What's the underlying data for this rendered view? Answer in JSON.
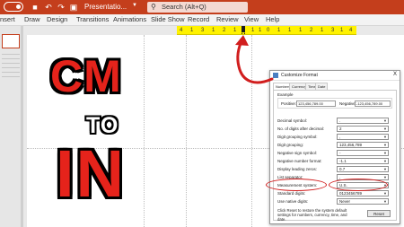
{
  "titlebar": {
    "title": "Presentatio...",
    "search_placeholder": "Search (Alt+Q)",
    "bg_color": "#c43e1c"
  },
  "ribbon_tabs": [
    "nsert",
    "Draw",
    "Design",
    "Transitions",
    "Animations",
    "Slide Show",
    "Record",
    "Review",
    "View",
    "Help"
  ],
  "ruler": {
    "ticks": [
      "4",
      "1",
      "3",
      "1",
      "2",
      "1",
      "1",
      "1",
      "0",
      "1",
      "1",
      "1",
      "2",
      "1",
      "3",
      "1",
      "4"
    ],
    "highlight_color": "#fff200"
  },
  "slide": {
    "line1": "CM",
    "line2": "TO",
    "line3": "IN",
    "text_color": "#e5231b"
  },
  "dialog": {
    "title": "Customize Format",
    "close": "X",
    "tabs": [
      "Numbers",
      "Currency",
      "Time",
      "Date"
    ],
    "example_label": "Example",
    "positive_label": "Positive:",
    "positive_value": "123,456,789.00",
    "negative_label": "Negative:",
    "negative_value": "-123,456,789.00",
    "rows": [
      {
        "label": "Decimal symbol:",
        "value": "."
      },
      {
        "label": "No. of digits after decimal:",
        "value": "2"
      },
      {
        "label": "Digit grouping symbol:",
        "value": ","
      },
      {
        "label": "Digit grouping:",
        "value": "123,456,789"
      },
      {
        "label": "Negative sign symbol:",
        "value": "-"
      },
      {
        "label": "Negative number format:",
        "value": "-1.1"
      },
      {
        "label": "Display leading zeros:",
        "value": "0.7"
      },
      {
        "label": "List separator:",
        "value": ","
      },
      {
        "label": "Measurement system:",
        "value": "U.S."
      },
      {
        "label": "Standard digits:",
        "value": "0123456789"
      },
      {
        "label": "Use native digits:",
        "value": "Never"
      }
    ],
    "hint": "Click Reset to restore the system default settings for numbers, currency, time, and date.",
    "reset_label": "Reset"
  },
  "annotation_color": "#d11e1e"
}
